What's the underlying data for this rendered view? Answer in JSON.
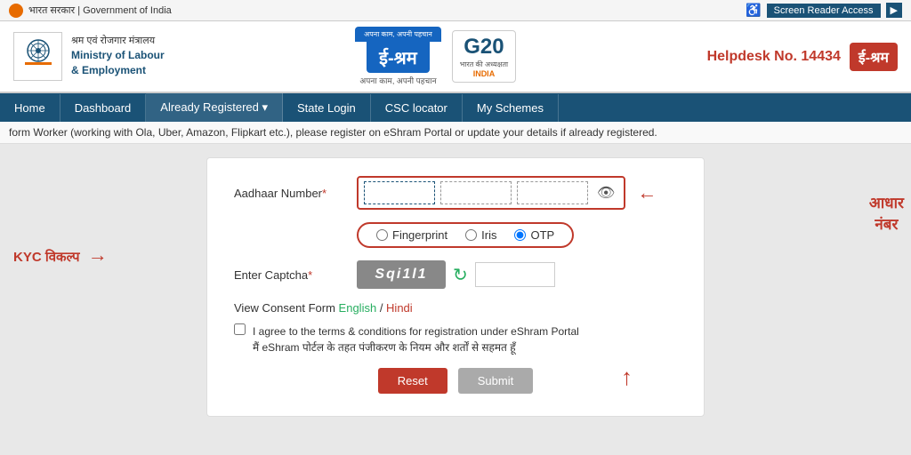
{
  "topbar": {
    "gov_text": "भारत सरकार | Government of India",
    "screen_reader": "Screen Reader Access",
    "arr_label": "▶"
  },
  "header": {
    "ministry_line1": "श्रम एवं रोजगार मंत्रालय",
    "ministry_line2": "Ministry of Labour",
    "ministry_line3": "& Employment",
    "eshram_brand": "ई-श्रम",
    "eshram_tagline": "अपना काम, अपनी पहचान",
    "g20_text": "G20",
    "g20_sub": "भारत की अध्यक्षता",
    "india": "INDIA",
    "helpdesk_label": "Helpdesk No. 14434",
    "eshram_right": "ई-श्रम"
  },
  "nav": {
    "items": [
      {
        "label": "Home",
        "active": false
      },
      {
        "label": "Dashboard",
        "active": false
      },
      {
        "label": "Already Registered ▾",
        "active": true
      },
      {
        "label": "State Login",
        "active": false
      },
      {
        "label": "CSC locator",
        "active": false
      },
      {
        "label": "My Schemes",
        "active": false
      }
    ]
  },
  "ticker": {
    "text": "form Worker (working with Ola, Uber, Amazon, Flipkart etc.), please register on eShram Portal or update your details if already registered."
  },
  "form": {
    "aadhaar_label": "Aadhaar Number",
    "aadhaar_req": "*",
    "captcha_label": "Enter Captcha",
    "captcha_req": "*",
    "captcha_value": "Sqi1l1",
    "kyc_options": [
      {
        "label": "Fingerprint",
        "value": "fingerprint",
        "checked": false
      },
      {
        "label": "Iris",
        "value": "iris",
        "checked": false
      },
      {
        "label": "OTP",
        "value": "otp",
        "checked": true
      }
    ],
    "consent_link_label": "View Consent Form",
    "consent_english": "English",
    "consent_hindi": "Hindi",
    "consent_text_en": "I agree to the terms & conditions for registration under eShram Portal",
    "consent_text_hi": "मैं eShram पोर्टल के तहत पंजीकरण के नियम और शर्तों से सहमत हूँ",
    "btn_reset": "Reset",
    "btn_submit": "Submit"
  },
  "annotations": {
    "kyc_label": "KYC विकल्प",
    "aadhaar_right1": "आधार",
    "aadhaar_right2": "नंबर"
  }
}
